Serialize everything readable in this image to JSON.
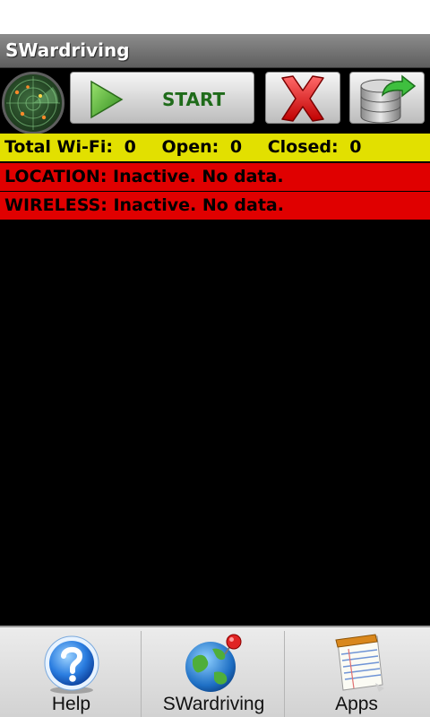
{
  "app": {
    "title": "SWardriving"
  },
  "toolbar": {
    "start_label": "START"
  },
  "counts": {
    "total_label": "Total Wi-Fi:",
    "total_value": "0",
    "open_label": "Open:",
    "open_value": "0",
    "closed_label": "Closed:",
    "closed_value": "0"
  },
  "status": {
    "location": "LOCATION: Inactive. No data.",
    "wireless": "WIRELESS: Inactive. No data."
  },
  "bottom_nav": {
    "items": [
      {
        "label": "Help",
        "icon": "help-icon"
      },
      {
        "label": "SWardriving",
        "icon": "globe-pin-icon"
      },
      {
        "label": "Apps",
        "icon": "notepad-icon"
      }
    ]
  },
  "colors": {
    "counts_bg": "#e2e000",
    "status_bg": "#e00000",
    "start_text": "#1f6b1a",
    "background": "#000000"
  }
}
